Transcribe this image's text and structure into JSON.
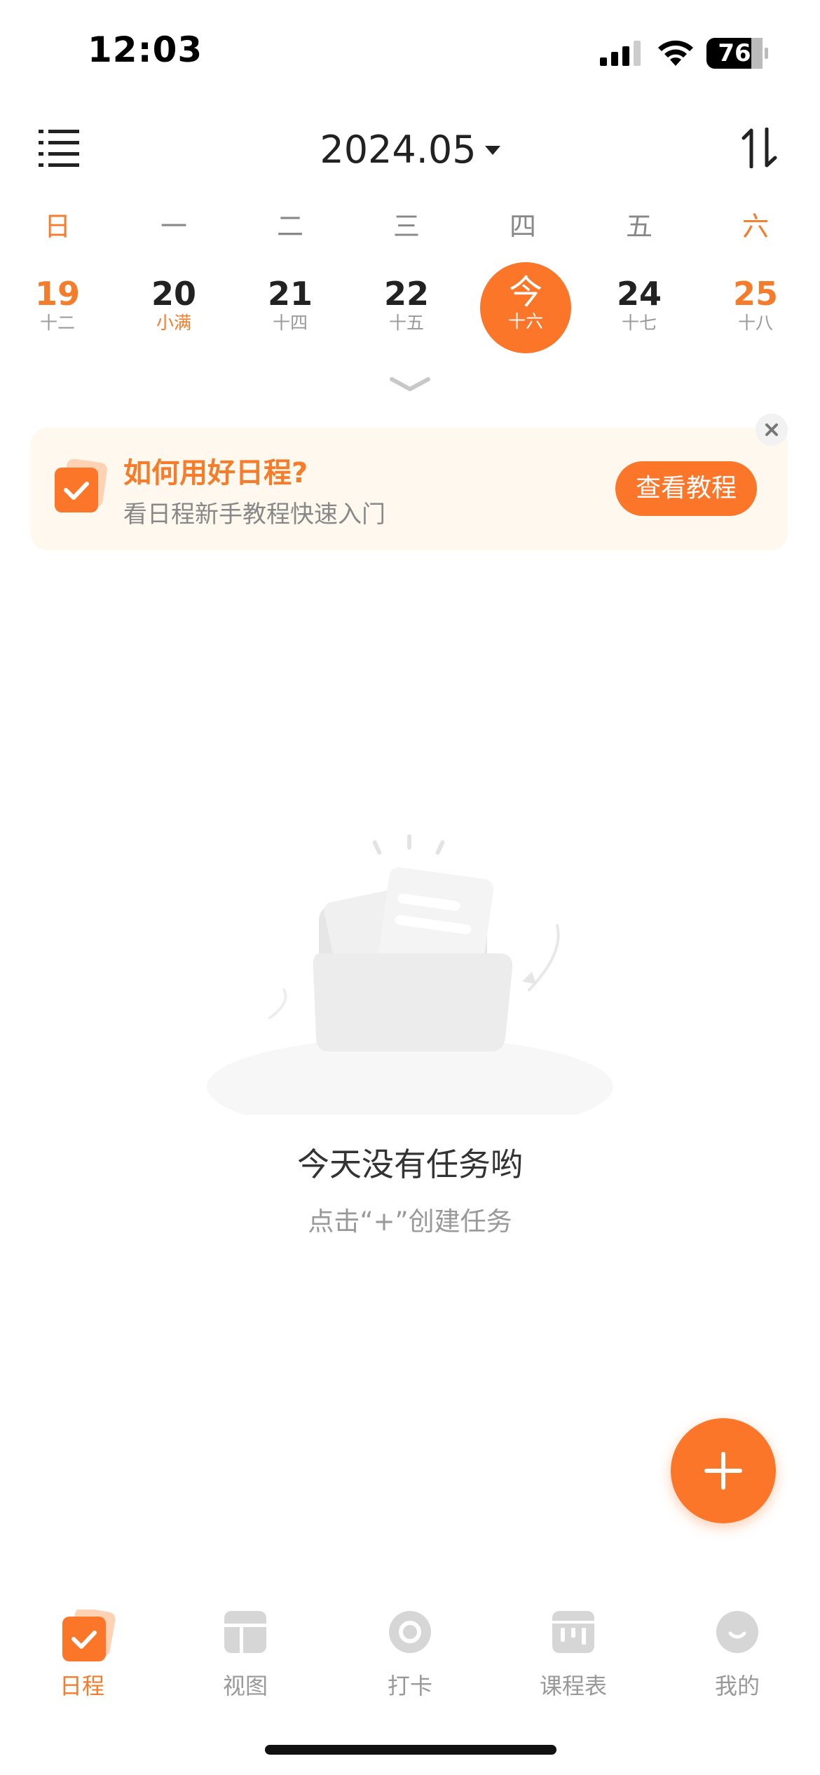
{
  "status_bar": {
    "time": "12:03",
    "battery": "76"
  },
  "header": {
    "month": "2024.05",
    "menu_icon": "list-menu-icon",
    "sort_icon": "sort-icon"
  },
  "weekdays": [
    "日",
    "一",
    "二",
    "三",
    "四",
    "五",
    "六"
  ],
  "dates": [
    {
      "num": "19",
      "lunar": "十二"
    },
    {
      "num": "20",
      "lunar": "小满"
    },
    {
      "num": "21",
      "lunar": "十四"
    },
    {
      "num": "22",
      "lunar": "十五"
    },
    {
      "num": "今",
      "lunar": "十六"
    },
    {
      "num": "24",
      "lunar": "十七"
    },
    {
      "num": "25",
      "lunar": "十八"
    }
  ],
  "banner": {
    "title": "如何用好日程?",
    "subtitle": "看日程新手教程快速入门",
    "button": "查看教程"
  },
  "empty": {
    "title": "今天没有任务哟",
    "hint": "点击“+”创建任务"
  },
  "tabs": [
    {
      "label": "日程",
      "icon": "schedule-icon",
      "active": true
    },
    {
      "label": "视图",
      "icon": "view-icon",
      "active": false
    },
    {
      "label": "打卡",
      "icon": "check-in-icon",
      "active": false
    },
    {
      "label": "课程表",
      "icon": "timetable-icon",
      "active": false
    },
    {
      "label": "我的",
      "icon": "profile-icon",
      "active": false
    }
  ],
  "colors": {
    "accent": "#fb7629",
    "banner_bg": "#fff8ef",
    "muted": "#999999"
  }
}
